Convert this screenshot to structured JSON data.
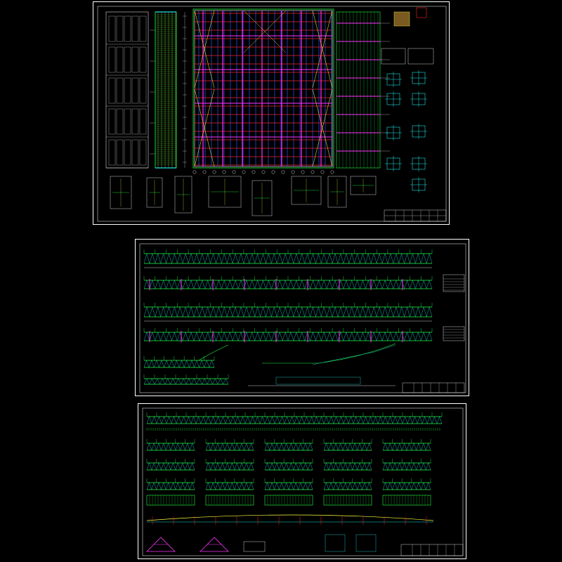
{
  "sheets": [
    {
      "id": "plan-and-details"
    },
    {
      "id": "truss-elevations"
    },
    {
      "id": "purlin-and-bracing-elevations"
    }
  ],
  "colors": {
    "background": "#000000",
    "frame": "#ffffff",
    "grid_red": "#ff2020",
    "member_blue": "#3050ff",
    "member_magenta": "#ff30ff",
    "chord_green": "#20ff40",
    "detail_cyan": "#20e0e0",
    "dim_white": "#ffffff",
    "note_yellow": "#ffff40"
  }
}
